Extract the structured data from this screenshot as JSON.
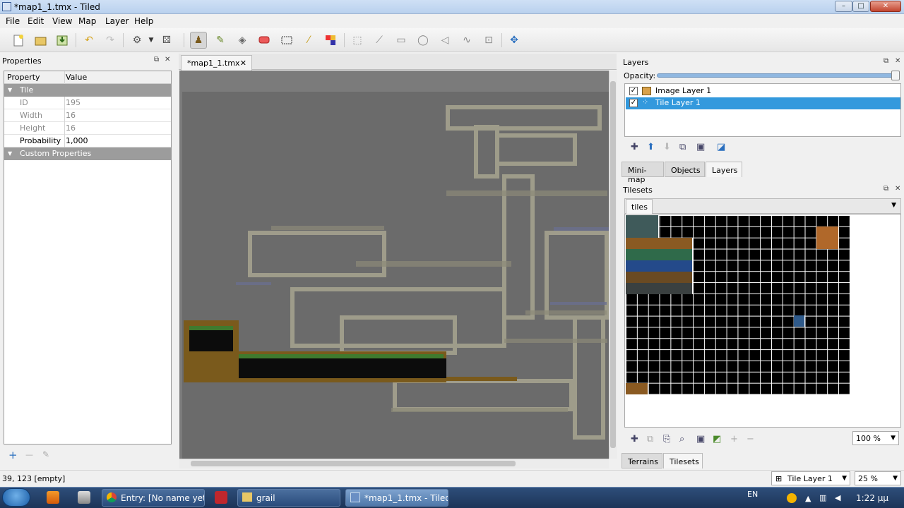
{
  "window": {
    "title": "*map1_1.tmx - Tiled",
    "min": "–",
    "max": "□",
    "close": "✕"
  },
  "menu": [
    "File",
    "Edit",
    "View",
    "Map",
    "Layer",
    "Help"
  ],
  "properties": {
    "title": "Properties",
    "header": {
      "col1": "Property",
      "col2": "Value"
    },
    "group_tile": "Tile",
    "rows": [
      {
        "name": "ID",
        "value": "195"
      },
      {
        "name": "Width",
        "value": "16"
      },
      {
        "name": "Height",
        "value": "16"
      },
      {
        "name": "Probability",
        "value": "1,000"
      }
    ],
    "group_custom": "Custom Properties",
    "add": "+",
    "remove": "—",
    "edit": "✎"
  },
  "editor": {
    "tab_label": "*map1_1.tmx",
    "tab_close": "✕"
  },
  "layers": {
    "title": "Layers",
    "opacity_label": "Opacity:",
    "opacity": 1.0,
    "items": [
      {
        "name": "Image Layer 1",
        "visible": true
      },
      {
        "name": "Tile Layer 1",
        "visible": true
      }
    ],
    "check": "✓",
    "tabs": [
      "Mini-map",
      "Objects",
      "Layers"
    ]
  },
  "tilesets": {
    "title": "Tilesets",
    "tab": "tiles",
    "zoom": "100 %",
    "bottom_tabs": [
      "Terrains",
      "Tilesets"
    ]
  },
  "status": {
    "coord": "39, 123 [empty]",
    "layer": "Tile Layer 1",
    "zoom": "25 %"
  },
  "taskbar": {
    "windows": [
      "Entry: [No name yet]...",
      "grail",
      "*map1_1.tmx - Tiled"
    ],
    "lang": "EN",
    "clock": "1:22 μμ"
  },
  "colors": {
    "selection": "#3399dd",
    "map_bg": "#6b6b6b",
    "taskbar": "#1c3458"
  }
}
